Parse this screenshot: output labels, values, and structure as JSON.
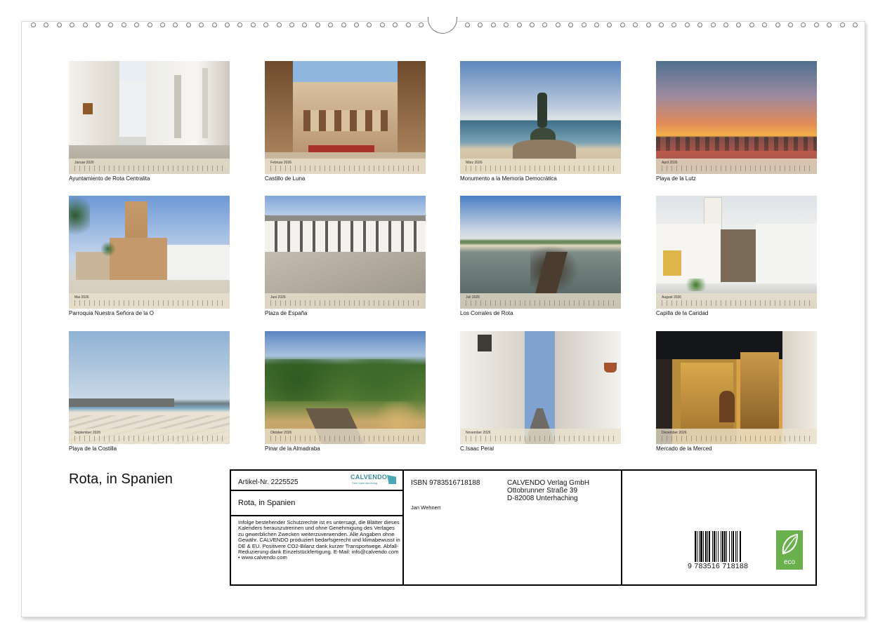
{
  "photos": [
    {
      "month": "Januar 2026",
      "caption": "Ayuntamiento de Rota Centralita"
    },
    {
      "month": "Februar 2026",
      "caption": "Castillo de Luna"
    },
    {
      "month": "März 2026",
      "caption": "Monumento a la Memoria Democrática"
    },
    {
      "month": "April 2026",
      "caption": "Playa de la Lutz"
    },
    {
      "month": "Mai 2026",
      "caption": "Parroquia Nuestra Señora de la O"
    },
    {
      "month": "Juni 2026",
      "caption": "Plaza de España"
    },
    {
      "month": "Juli 2026",
      "caption": "Los Corrales de Rota"
    },
    {
      "month": "August 2026",
      "caption": "Capilla de la Caridad"
    },
    {
      "month": "September 2026",
      "caption": "Playa de la Costilla"
    },
    {
      "month": "Oktober 2026",
      "caption": "Pinar de la Almadraba"
    },
    {
      "month": "November 2026",
      "caption": "C.Isaac Peral"
    },
    {
      "month": "Dezember 2026",
      "caption": "Mercado de la Merced"
    }
  ],
  "footer": {
    "title": "Rota, in Spanien",
    "article_no": "Artikel-Nr. 2225525",
    "publisher_logo": "CALVENDO",
    "publisher_logo_sub": "Dein Kalenderverlag",
    "box_title": "Rota, in Spanien",
    "legal": "Infolge bestehender Schutzrechte ist es untersagt, die Blätter dieses Kalenders herauszutrennen und ohne Genehmigung des Verlages zu gewerblichen Zwecken weiterzuverwenden. Alle Angaben ohne Gewähr. CALVENDO produziert bedarfsgerecht und klimabewusst in DE & EU. Positivere CO2-Bilanz dank kurzer Transportwege. Abfall-Reduzierung dank Einzelstückfertigung. E-Mail: info@calvendo.com • www.calvendo.com",
    "isbn": "ISBN 9783516718188",
    "author": "Jan Wehnert",
    "publisher_name": "CALVENDO Verlag GmbH",
    "publisher_street": "Ottobrunner Straße 39",
    "publisher_city": "D-82008 Unterhaching",
    "barcode_number": "9 783516 718188",
    "eco_label": "eco"
  },
  "colors": {
    "strip": "#ebe1cd",
    "eco_green": "#6ab04c",
    "logo_teal": "#3a8a9a"
  }
}
